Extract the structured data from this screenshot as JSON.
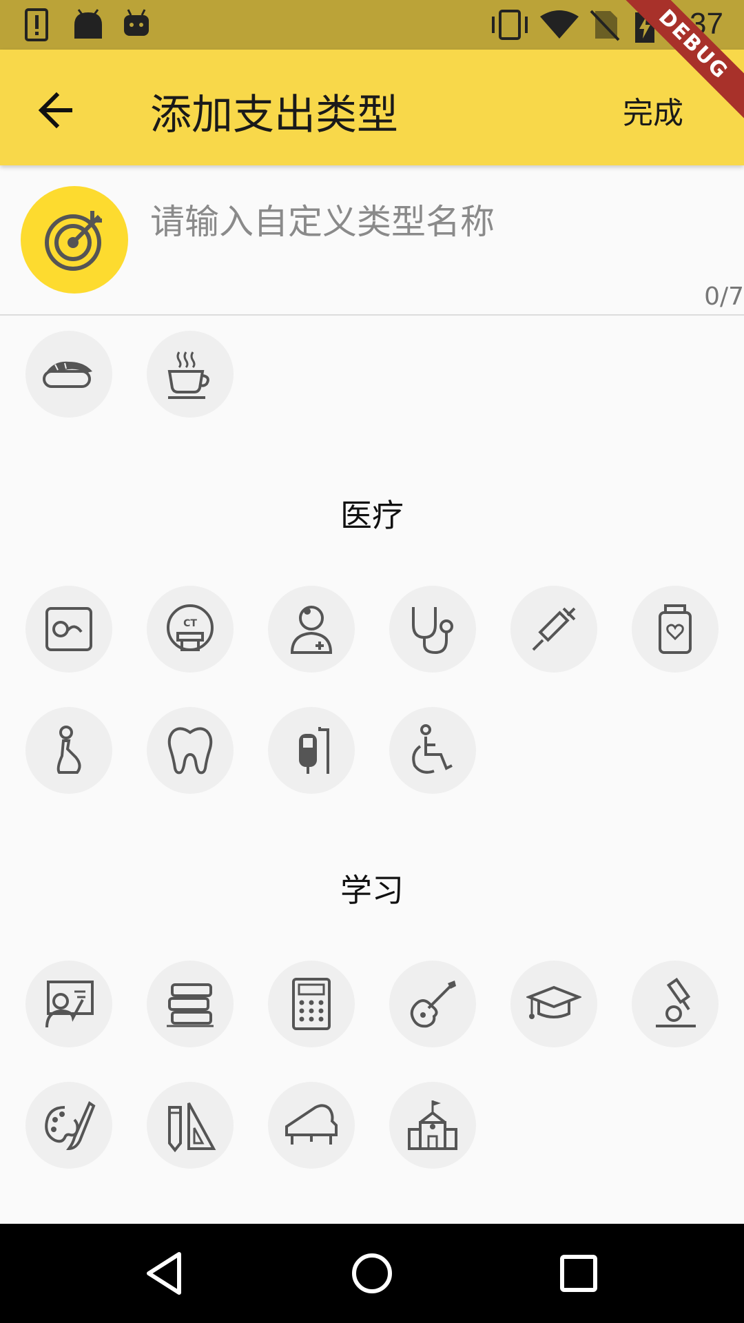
{
  "status_bar": {
    "time": "2:37",
    "icons": [
      "alert-icon",
      "android-icon",
      "android-robot-icon",
      "vibrate-icon",
      "wifi-icon",
      "no-sim-icon",
      "battery-charging-icon"
    ]
  },
  "debug_banner": "DEBUG",
  "app_bar": {
    "title": "添加支出类型",
    "done_label": "完成",
    "back_icon": "arrow-back-icon"
  },
  "input": {
    "placeholder": "请输入自定义类型名称",
    "counter": "0/7",
    "selected_icon": "target-icon"
  },
  "sections": [
    {
      "title": "",
      "icons": [
        "sushi-icon",
        "hot-drink-icon"
      ]
    },
    {
      "title": "医疗",
      "icons": [
        "ultrasound-icon",
        "ct-scan-icon",
        "doctor-icon",
        "stethoscope-icon",
        "syringe-icon",
        "medicine-bottle-icon",
        "pregnant-icon",
        "tooth-icon",
        "iv-drip-icon",
        "wheelchair-icon"
      ]
    },
    {
      "title": "学习",
      "icons": [
        "teacher-icon",
        "books-icon",
        "calculator-icon",
        "guitar-icon",
        "graduation-cap-icon",
        "microscope-icon",
        "palette-icon",
        "ruler-pencil-icon",
        "piano-icon",
        "school-icon"
      ]
    }
  ],
  "nav_bar": {
    "icons": [
      "back-triangle-icon",
      "home-circle-icon",
      "recents-square-icon"
    ]
  }
}
